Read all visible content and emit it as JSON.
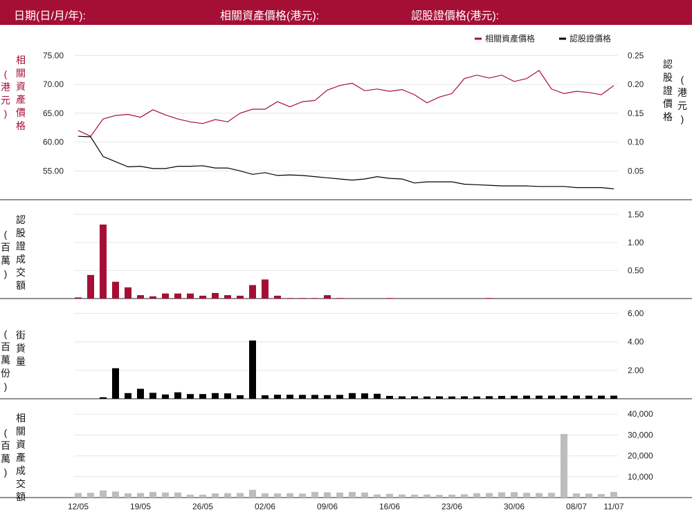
{
  "header": {
    "date_label": "日期(日/月/年):",
    "underlying_label": "相關資產價格(港元):",
    "warrant_label": "認股證價格(港元):"
  },
  "colors": {
    "header_bg": "#a50f35",
    "underlying": "#a50f35",
    "warrant": "#000000",
    "turnover_bar": "#bdbdbd"
  },
  "axis_labels": {
    "left_price": [
      "相",
      "關",
      "資",
      "產",
      "價",
      "格"
    ],
    "left_price_unit": [
      "(",
      "港",
      "元",
      ")"
    ],
    "right_price": [
      "認",
      "股",
      "證",
      "價",
      "格"
    ],
    "right_price_unit": [
      "(",
      "港",
      "元",
      ")"
    ],
    "panel2": [
      "認",
      "股",
      "證",
      "成",
      "交",
      "額"
    ],
    "panel2_unit": [
      "(",
      "百",
      "萬",
      ")"
    ],
    "panel3": [
      "街",
      "貨",
      "量"
    ],
    "panel3_unit": [
      "(",
      "百",
      "萬",
      "份",
      ")"
    ],
    "panel4": [
      "相",
      "關",
      "資",
      "產",
      "成",
      "交",
      "額"
    ],
    "panel4_unit": [
      "(",
      "百",
      "萬",
      ")"
    ]
  },
  "chart_data": [
    {
      "type": "line",
      "legend": [
        "相關資產價格",
        "認股證價格"
      ],
      "legend_position": "top-right",
      "x_tick_labels": [
        "12/05",
        "19/05",
        "26/05",
        "02/06",
        "09/06",
        "16/06",
        "23/06",
        "30/06",
        "08/07",
        "11/07"
      ],
      "x_tick_indices": [
        0,
        5,
        10,
        15,
        20,
        25,
        30,
        35,
        40,
        43
      ],
      "series": [
        {
          "name": "相關資產價格",
          "axis": "left",
          "values": [
            62.0,
            61.0,
            64.0,
            64.6,
            64.8,
            64.3,
            65.6,
            64.7,
            64.0,
            63.5,
            63.2,
            63.9,
            63.5,
            65.0,
            65.7,
            65.7,
            67.0,
            66.1,
            67.0,
            67.2,
            69.0,
            69.8,
            70.2,
            68.9,
            69.2,
            68.8,
            69.1,
            68.2,
            66.8,
            67.8,
            68.4,
            71.0,
            71.6,
            71.1,
            71.6,
            70.5,
            71.0,
            72.4,
            69.2,
            68.4,
            68.8,
            68.6,
            68.2,
            69.8
          ]
        },
        {
          "name": "認股證價格",
          "axis": "right",
          "values": [
            0.11,
            0.109,
            0.075,
            0.066,
            0.057,
            0.058,
            0.054,
            0.054,
            0.058,
            0.058,
            0.059,
            0.055,
            0.055,
            0.05,
            0.044,
            0.047,
            0.042,
            0.043,
            0.042,
            0.04,
            0.038,
            0.036,
            0.034,
            0.036,
            0.04,
            0.037,
            0.036,
            0.029,
            0.031,
            0.031,
            0.031,
            0.027,
            0.026,
            0.025,
            0.024,
            0.024,
            0.024,
            0.023,
            0.023,
            0.023,
            0.021,
            0.021,
            0.021,
            0.019
          ]
        }
      ],
      "ylim_left": [
        50,
        76
      ],
      "ticks_left": [
        "75.00",
        "70.00",
        "65.00",
        "60.00",
        "55.00"
      ],
      "ylim_right": [
        0,
        0.26
      ],
      "ticks_right": [
        "0.25",
        "0.20",
        "0.15",
        "0.10",
        "0.05"
      ],
      "grid": true
    },
    {
      "type": "bar",
      "name": "認股證成交額",
      "values": [
        0.02,
        0.42,
        1.32,
        0.3,
        0.2,
        0.06,
        0.04,
        0.09,
        0.09,
        0.09,
        0.05,
        0.1,
        0.06,
        0.05,
        0.24,
        0.34,
        0.05,
        0.01,
        0.01,
        0.01,
        0.06,
        0.01,
        0,
        0,
        0,
        0.01,
        0,
        0,
        0,
        0,
        0,
        0,
        0,
        0.01,
        0,
        0,
        0,
        0,
        0,
        0,
        0,
        0,
        0,
        0
      ],
      "ylim": [
        0,
        1.75
      ],
      "ticks": [
        "1.50",
        "1.00",
        "0.50"
      ],
      "grid": true
    },
    {
      "type": "bar",
      "name": "街貨量",
      "values": [
        0,
        0,
        0.1,
        2.15,
        0.4,
        0.7,
        0.42,
        0.3,
        0.45,
        0.33,
        0.33,
        0.4,
        0.38,
        0.25,
        4.1,
        0.25,
        0.28,
        0.28,
        0.27,
        0.27,
        0.26,
        0.27,
        0.4,
        0.38,
        0.35,
        0.2,
        0.17,
        0.17,
        0.16,
        0.17,
        0.16,
        0.17,
        0.16,
        0.18,
        0.2,
        0.21,
        0.22,
        0.22,
        0.22,
        0.22,
        0.22,
        0.22,
        0.22,
        0.22
      ],
      "ylim": [
        0,
        7
      ],
      "ticks": [
        "6.00",
        "4.00",
        "2.00"
      ],
      "grid": true
    },
    {
      "type": "bar",
      "name": "相關資產成交額",
      "values": [
        2200,
        2300,
        3400,
        2900,
        2100,
        2200,
        2700,
        2400,
        2400,
        1400,
        1400,
        2000,
        2100,
        2200,
        3700,
        2100,
        2000,
        2100,
        1900,
        2700,
        2500,
        2400,
        2700,
        2400,
        1500,
        1800,
        1500,
        1400,
        1500,
        1300,
        1400,
        1600,
        2100,
        2200,
        2500,
        2600,
        2300,
        2200,
        2300,
        30500,
        2000,
        1900,
        1700,
        2700
      ],
      "ylim": [
        0,
        47000
      ],
      "ticks": [
        "40,000",
        "30,000",
        "20,000",
        "10,000"
      ],
      "grid": true
    }
  ]
}
